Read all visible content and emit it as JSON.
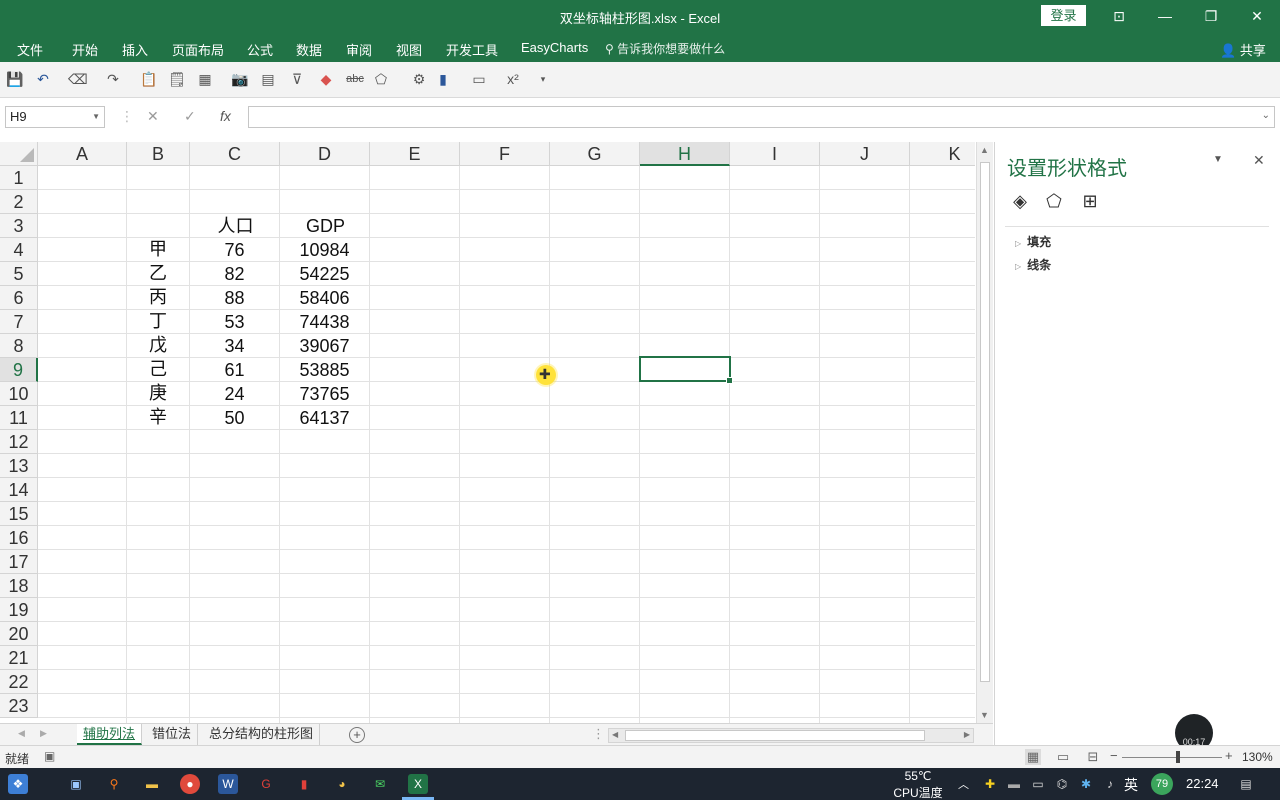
{
  "window": {
    "title": "双坐标轴柱形图.xlsx  -  Excel",
    "login_label": "登录",
    "controls": [
      "⊡",
      "—",
      "❐",
      "✕"
    ]
  },
  "ribbon": {
    "tabs": [
      "文件",
      "开始",
      "插入",
      "页面布局",
      "公式",
      "数据",
      "审阅",
      "视图",
      "开发工具",
      "EasyCharts"
    ],
    "tell_me": "告诉我你想要做什么",
    "share": "共享"
  },
  "qat": {
    "icons": [
      "save-icon",
      "undo-icon",
      "redo-icon",
      "paste-icon",
      "camera-icon",
      "filter-icon",
      "eraser-icon",
      "strikethrough-icon",
      "chart-icon",
      "superscript-icon"
    ],
    "superscript_label": "x²",
    "strike_label": "abc"
  },
  "formula_bar": {
    "name_box": "H9",
    "cancel": "✕",
    "enter": "✓",
    "fx": "fx",
    "formula": ""
  },
  "grid": {
    "columns": [
      "A",
      "B",
      "C",
      "D",
      "E",
      "F",
      "G",
      "H",
      "I",
      "J",
      "K"
    ],
    "selected_column": "H",
    "rows": [
      "1",
      "2",
      "3",
      "4",
      "5",
      "6",
      "7",
      "8",
      "9",
      "10",
      "11",
      "12",
      "13",
      "14",
      "15",
      "16",
      "17",
      "18",
      "19",
      "20",
      "21",
      "22",
      "23"
    ],
    "selected_row": "9",
    "header_row": {
      "population": "人口",
      "gdp": "GDP"
    },
    "data_rows": [
      {
        "name": "甲",
        "population": "76",
        "gdp": "10984"
      },
      {
        "name": "乙",
        "population": "82",
        "gdp": "54225"
      },
      {
        "name": "丙",
        "population": "88",
        "gdp": "58406"
      },
      {
        "name": "丁",
        "population": "53",
        "gdp": "74438"
      },
      {
        "name": "戊",
        "population": "34",
        "gdp": "39067"
      },
      {
        "name": "己",
        "population": "61",
        "gdp": "53885"
      },
      {
        "name": "庚",
        "population": "24",
        "gdp": "73765"
      },
      {
        "name": "辛",
        "population": "50",
        "gdp": "64137"
      }
    ]
  },
  "sheets": {
    "tabs": [
      "辅助列法",
      "错位法",
      "总分结构的柱形图"
    ],
    "active": "辅助列法",
    "add_label": "+"
  },
  "panel": {
    "title": "设置形状格式",
    "sections": [
      "填充",
      "线条"
    ],
    "timer": "00:17"
  },
  "status": {
    "ready": "就绪",
    "zoom": "130%",
    "zoom_fraction": 0.54
  },
  "taskbar": {
    "temperature": "55℃",
    "cpu_label": "CPU温度",
    "ime": "英",
    "badge": "79",
    "time": "22:24"
  },
  "colors": {
    "excel_green": "#217346",
    "taskbar": "#1d2530"
  }
}
